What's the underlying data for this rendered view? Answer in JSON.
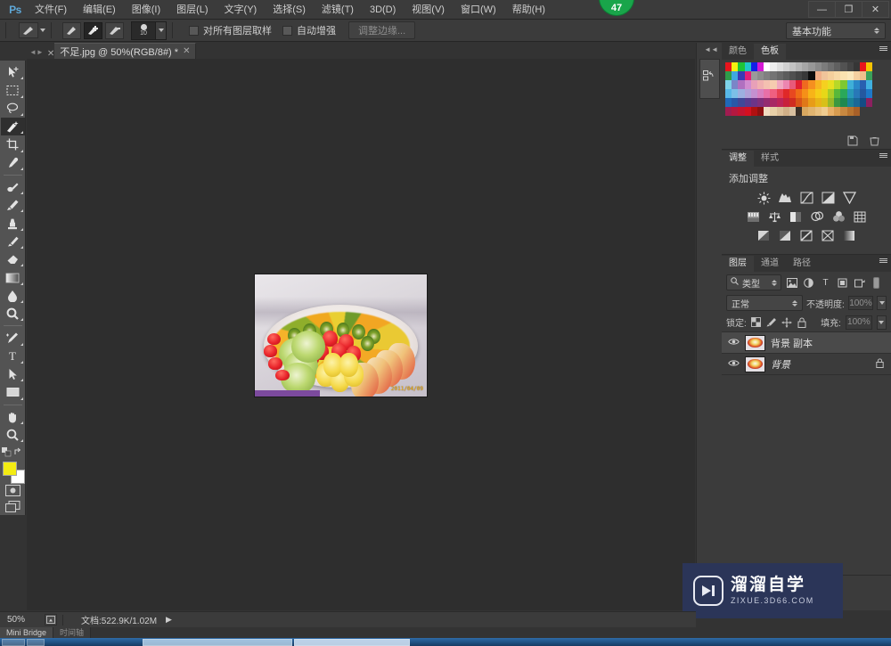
{
  "app": {
    "logo_text": "Ps",
    "notification_badge": "47"
  },
  "menubar": {
    "items": [
      {
        "label": "文件(F)",
        "name": "menu-file"
      },
      {
        "label": "编辑(E)",
        "name": "menu-edit"
      },
      {
        "label": "图像(I)",
        "name": "menu-image"
      },
      {
        "label": "图层(L)",
        "name": "menu-layer"
      },
      {
        "label": "文字(Y)",
        "name": "menu-type"
      },
      {
        "label": "选择(S)",
        "name": "menu-select"
      },
      {
        "label": "滤镜(T)",
        "name": "menu-filter"
      },
      {
        "label": "3D(D)",
        "name": "menu-3d"
      },
      {
        "label": "视图(V)",
        "name": "menu-view"
      },
      {
        "label": "窗口(W)",
        "name": "menu-window"
      },
      {
        "label": "帮助(H)",
        "name": "menu-help"
      }
    ],
    "window_controls": {
      "minimize": "—",
      "restore": "❐",
      "close": "✕"
    }
  },
  "options_bar": {
    "brush_size": "10",
    "sample_all_layers_label": "对所有图层取样",
    "auto_enhance_label": "自动增强",
    "refine_edge_label": "调整边缘...",
    "workspace": "基本功能"
  },
  "document_tab": {
    "title": "不足.jpg @ 50%(RGB/8#) *",
    "close_glyph": "✕"
  },
  "toolbar": {
    "tools": [
      {
        "name": "move-tool",
        "glyph": "✛"
      },
      {
        "name": "marquee-tool",
        "glyph": "▢"
      },
      {
        "name": "lasso-tool",
        "glyph": "◯"
      },
      {
        "name": "quick-selection-tool",
        "glyph": "✦",
        "active": true
      },
      {
        "name": "crop-tool",
        "glyph": "⌗"
      },
      {
        "name": "eyedropper-tool",
        "glyph": "✎"
      },
      {
        "name": "healing-brush-tool",
        "glyph": "⚕"
      },
      {
        "name": "brush-tool",
        "glyph": "🖌"
      },
      {
        "name": "clone-stamp-tool",
        "glyph": "⚒"
      },
      {
        "name": "history-brush-tool",
        "glyph": "↻"
      },
      {
        "name": "eraser-tool",
        "glyph": "⌫"
      },
      {
        "name": "gradient-tool",
        "glyph": "▤"
      },
      {
        "name": "blur-tool",
        "glyph": "💧"
      },
      {
        "name": "dodge-tool",
        "glyph": "🔍"
      },
      {
        "name": "pen-tool",
        "glyph": "✒"
      },
      {
        "name": "type-tool",
        "glyph": "T"
      },
      {
        "name": "path-selection-tool",
        "glyph": "▶"
      },
      {
        "name": "rectangle-shape-tool",
        "glyph": "▭"
      },
      {
        "name": "hand-tool",
        "glyph": "✋"
      },
      {
        "name": "zoom-tool",
        "glyph": "🔍"
      }
    ],
    "foreground_color": "#f4ec12",
    "background_color": "#ffffff"
  },
  "color_panel": {
    "tabs": [
      {
        "label": "颜色",
        "active": false
      },
      {
        "label": "色板",
        "active": true
      }
    ],
    "swatch_colors": [
      "#e8141c",
      "#f5f010",
      "#1fc436",
      "#1fc8c8",
      "#1420e8",
      "#d419d4",
      "#ffffff",
      "#ededed",
      "#dedede",
      "#d0d0d0",
      "#c2c2c2",
      "#b4b4b4",
      "#a6a6a6",
      "#989898",
      "#8a8a8a",
      "#7c7c7c",
      "#6e6e6e",
      "#606060",
      "#525252",
      "#444444",
      "#363636",
      "#e8141c",
      "#f5c400",
      "#2f9c4a",
      "#3fa8e0",
      "#3a3ab4",
      "#e01e78",
      "#9a9a9a",
      "#8c8c8c",
      "#808080",
      "#747474",
      "#686868",
      "#5c5c5c",
      "#505050",
      "#444444",
      "#383838",
      "#0d0d0d",
      "#f0b08a",
      "#f0c49a",
      "#f5cf9c",
      "#f8d9a6",
      "#fae2b0",
      "#fbe8bc",
      "#f5d0a0",
      "#eec08c",
      "#3aa05a",
      "#7ed2e8",
      "#7a86c8",
      "#b070c0",
      "#d08cd0",
      "#e8a0b8",
      "#f0b0b0",
      "#f4c0b0",
      "#f6ccb0",
      "#f0a8c0",
      "#ec86b0",
      "#e85a7a",
      "#e02030",
      "#ef6a20",
      "#f59020",
      "#f7b520",
      "#f5d020",
      "#e8e020",
      "#b8d828",
      "#7ec832",
      "#3fb0d8",
      "#2a88c8",
      "#2860b0",
      "#40b0e0",
      "#58b8e8",
      "#7cc0e8",
      "#9cb0e0",
      "#b0a0d8",
      "#c490d0",
      "#d880c0",
      "#e870a8",
      "#f06080",
      "#e84050",
      "#e02828",
      "#e84820",
      "#ef6c18",
      "#f59018",
      "#f7b418",
      "#f5cc18",
      "#e6d818",
      "#a8cc28",
      "#58b83a",
      "#2aa85a",
      "#2898b8",
      "#2878b8",
      "#2458a0",
      "#1e78c8",
      "#2068b8",
      "#2858a8",
      "#404898",
      "#583c90",
      "#6c3488",
      "#80307c",
      "#942c70",
      "#a82864",
      "#bc2458",
      "#c8203c",
      "#d02c20",
      "#d85418",
      "#e07818",
      "#e89c18",
      "#e8b418",
      "#d8c018",
      "#98b828",
      "#3c9840",
      "#1e8850",
      "#1a8098",
      "#1a6898",
      "#144c84",
      "#8c2060",
      "#a01c50",
      "#b41840",
      "#c41430",
      "#d41020",
      "#b01010",
      "#8c1010",
      "#f0dcc0",
      "#e8d0a8",
      "#dcc098",
      "#d0b088",
      "#d8c0a0",
      "#3a3028",
      "#d8a860",
      "#e0b470",
      "#e8c080",
      "#f0cc90",
      "#e8b068",
      "#d89c50",
      "#c88840",
      "#b87430",
      "#a86028",
      ""
    ]
  },
  "adjustments_panel": {
    "tabs": [
      {
        "label": "调整",
        "active": true
      },
      {
        "label": "样式",
        "active": false
      }
    ],
    "title": "添加调整",
    "rows": [
      [
        {
          "name": "brightness-contrast-icon",
          "glyph": "☀"
        },
        {
          "name": "levels-icon",
          "glyph": "▥"
        },
        {
          "name": "curves-icon",
          "glyph": "◸"
        },
        {
          "name": "exposure-icon",
          "glyph": "◪"
        },
        {
          "name": "vibrance-icon",
          "glyph": "▽"
        }
      ],
      [
        {
          "name": "hue-saturation-icon",
          "glyph": "▦"
        },
        {
          "name": "color-balance-icon",
          "glyph": "⚖"
        },
        {
          "name": "black-white-icon",
          "glyph": "◨"
        },
        {
          "name": "photo-filter-icon",
          "glyph": "◍"
        },
        {
          "name": "channel-mixer-icon",
          "glyph": "❃"
        },
        {
          "name": "color-lookup-icon",
          "glyph": "▦"
        }
      ],
      [
        {
          "name": "invert-icon",
          "glyph": "◩"
        },
        {
          "name": "posterize-icon",
          "glyph": "◪"
        },
        {
          "name": "threshold-icon",
          "glyph": "◸"
        },
        {
          "name": "gradient-map-icon",
          "glyph": "⧅"
        },
        {
          "name": "selective-color-icon",
          "glyph": "▤"
        }
      ]
    ]
  },
  "layers_panel": {
    "tabs": [
      {
        "label": "图层",
        "active": true
      },
      {
        "label": "通道",
        "active": false
      },
      {
        "label": "路径",
        "active": false
      }
    ],
    "filter": {
      "search_icon": "search-icon",
      "kind_label": "类型",
      "kind_icons": [
        {
          "name": "filter-pixel-icon",
          "glyph": "▣"
        },
        {
          "name": "filter-adjustment-icon",
          "glyph": "◑"
        },
        {
          "name": "filter-type-icon",
          "glyph": "T"
        },
        {
          "name": "filter-shape-icon",
          "glyph": "▢"
        },
        {
          "name": "filter-smart-icon",
          "glyph": "⬘"
        }
      ],
      "toggle_glyph": "▮"
    },
    "blend_mode": "正常",
    "opacity_label": "不透明度:",
    "opacity_value": "100%",
    "lock_label": "锁定:",
    "lock_icons": [
      {
        "name": "lock-transparent-icon",
        "glyph": "▨"
      },
      {
        "name": "lock-image-icon",
        "glyph": "🖌"
      },
      {
        "name": "lock-position-icon",
        "glyph": "✛"
      },
      {
        "name": "lock-all-icon",
        "glyph": "🔒"
      }
    ],
    "fill_label": "填充:",
    "fill_value": "100%",
    "layers": [
      {
        "name": "背景 副本",
        "visible": true,
        "locked": false,
        "selected": true,
        "eye": "👁"
      },
      {
        "name": "背景",
        "visible": true,
        "locked": true,
        "selected": false,
        "eye": "👁",
        "lock_glyph": "🔒"
      }
    ]
  },
  "canvas": {
    "image_datestamp": "2011/04/09"
  },
  "status_bar": {
    "zoom": "50%",
    "doc_info": "文档:522.9K/1.02M",
    "arrow_glyph": "▶"
  },
  "bottom_tabs": [
    {
      "label": "Mini Bridge",
      "active": true
    },
    {
      "label": "时间轴",
      "active": false
    }
  ],
  "watermark": {
    "title": "溜溜自学",
    "url": "ZIXUE.3D66.COM"
  },
  "colors": {
    "panel_bg": "#3b3b3b",
    "canvas_bg": "#2e2e2e",
    "toolbar_bg": "#535353",
    "accent_badge": "#19a54a",
    "watermark_bg": "#2b3558"
  }
}
